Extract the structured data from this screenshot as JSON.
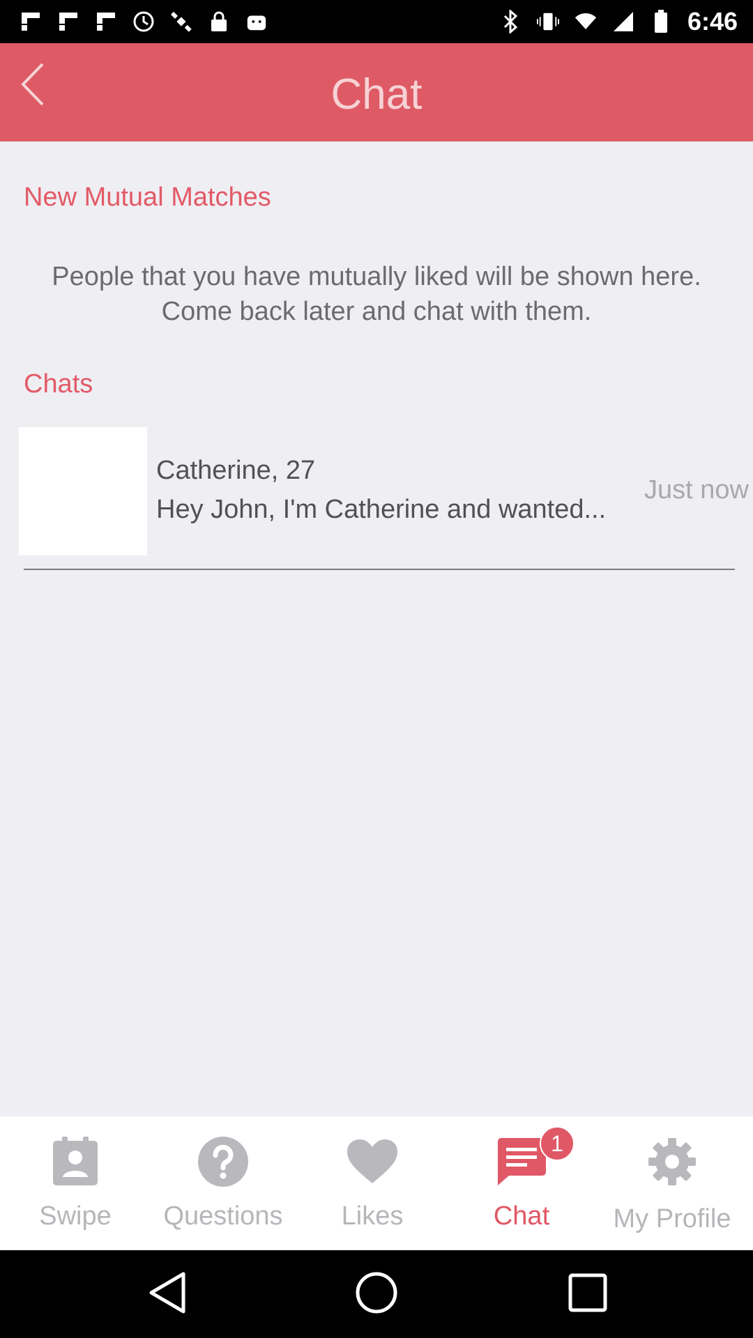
{
  "status_bar": {
    "time": "6:46",
    "left_icons": [
      "flipboard-icon",
      "flipboard-icon",
      "flipboard-icon",
      "sync-icon",
      "satellite-icon",
      "lock-icon",
      "android-icon"
    ],
    "right_icons": [
      "bluetooth-icon",
      "vibrate-icon",
      "wifi-icon",
      "signal-icon",
      "battery-icon"
    ]
  },
  "header": {
    "title": "Chat",
    "back_icon": "chevron-left-icon",
    "color": "#de5b66"
  },
  "matches": {
    "title": "New Mutual Matches",
    "empty_message": "People that you have mutually liked will be shown here. Come back later and chat with them."
  },
  "chats": {
    "title": "Chats",
    "items": [
      {
        "name": "Catherine, 27",
        "preview": "Hey John, I'm Catherine and wanted...",
        "time": "Just now"
      }
    ]
  },
  "tabs": [
    {
      "label": "Swipe",
      "icon": "contact-card-icon",
      "active": false
    },
    {
      "label": "Questions",
      "icon": "question-icon",
      "active": false
    },
    {
      "label": "Likes",
      "icon": "heart-icon",
      "active": false
    },
    {
      "label": "Chat",
      "icon": "chat-icon",
      "active": true,
      "badge": "1"
    },
    {
      "label": "My Profile",
      "icon": "gear-icon",
      "active": false
    }
  ],
  "accent_color": "#e05866",
  "nav_bar": {
    "buttons": [
      "back-icon",
      "home-icon",
      "recents-icon"
    ]
  }
}
